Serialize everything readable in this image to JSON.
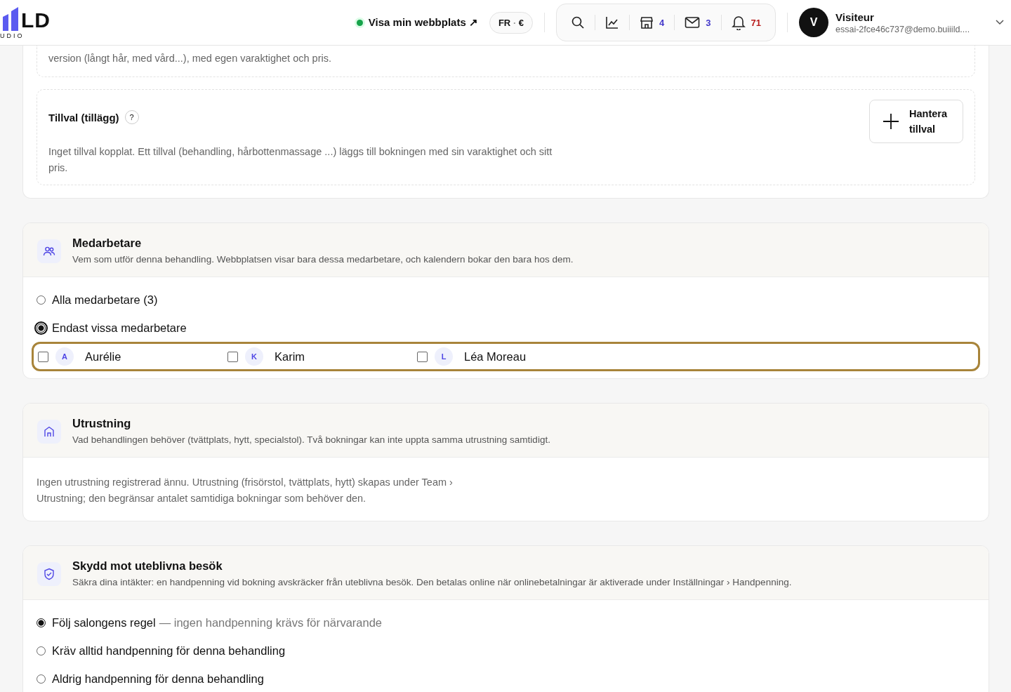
{
  "header": {
    "logo": {
      "mark": "LD",
      "sub": "UDIO"
    },
    "site_link": {
      "label": "Visa min webbplats ↗",
      "online": true
    },
    "locale": {
      "language": "FR",
      "separator": "·",
      "currency": "€"
    },
    "toolbar": [
      {
        "kind": "search"
      },
      {
        "kind": "stats"
      },
      {
        "kind": "store",
        "count": "4",
        "color": "#4338ca"
      },
      {
        "kind": "mail",
        "count": "3",
        "color": "#4338ca"
      },
      {
        "kind": "bell",
        "count": "71",
        "color": "#b91c1c"
      }
    ],
    "user": {
      "initial": "V",
      "name": "Visiteur",
      "email": "essai-2fce46c737@demo.buiiild...."
    }
  },
  "options_card": {
    "variant_note": "version (långt hår, med vård...), med egen varaktighet och pris.",
    "addons": {
      "title": "Tillval (tillägg)",
      "help": "?",
      "text": "Inget tillval kopplat. Ett tillval (behandling, hårbottenmassage ...) läggs till bokningen med sin varaktighet och sitt pris.",
      "button": "Hantera tillval"
    }
  },
  "staff": {
    "title": "Medarbetare",
    "description": "Vem som utför denna behandling. Webbplatsen visar bara dessa medarbetare, och kalendern bokar den bara hos dem.",
    "options": [
      {
        "label": "Alla medarbetare (3)",
        "selected": false,
        "focused": false
      },
      {
        "label": "Endast vissa medarbetare",
        "selected": true,
        "focused": true
      }
    ],
    "members_focused": true,
    "members": [
      {
        "initial": "A",
        "name": "Aurélie",
        "checked": false
      },
      {
        "initial": "K",
        "name": "Karim",
        "checked": false
      },
      {
        "initial": "L",
        "name": "Léa Moreau",
        "checked": false
      }
    ]
  },
  "equipment": {
    "title": "Utrustning",
    "description": "Vad behandlingen behöver (tvättplats, hytt, specialstol). Två bokningar kan inte uppta samma utrustning samtidigt.",
    "empty_text": "Ingen utrustning registrerad ännu. Utrustning (frisörstol, tvättplats, hytt) skapas under Team › Utrustning; den begränsar antalet samtidiga bokningar som behöver den."
  },
  "no_show": {
    "title": "Skydd mot uteblivna besök",
    "description": "Säkra dina intäkter: en handpenning vid bokning avskräcker från uteblivna besök. Den betalas online när onlinebetalningar är aktiverade under Inställningar › Handpenning.",
    "options": [
      {
        "label": "Följ salongens regel",
        "note": "— ingen handpenning krävs för närvarande",
        "selected": true
      },
      {
        "label": "Kräv alltid handpenning för denna behandling",
        "selected": false
      },
      {
        "label": "Aldrig handpenning för denna behandling",
        "selected": false
      }
    ]
  }
}
